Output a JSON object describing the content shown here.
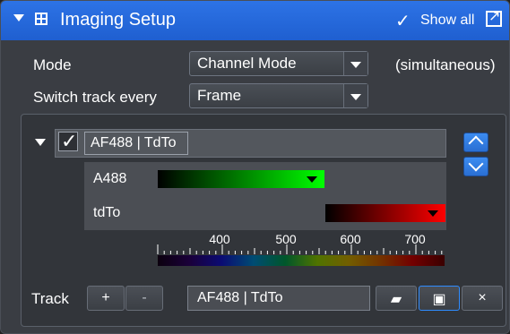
{
  "header": {
    "title": "Imaging Setup",
    "show_all_label": "Show all"
  },
  "settings": {
    "mode_label": "Mode",
    "mode_value": "Channel Mode",
    "mode_note": "(simultaneous)",
    "switch_label": "Switch track every",
    "switch_value": "Frame"
  },
  "track": {
    "name": "AF488 | TdTo",
    "checked": true,
    "channels": [
      {
        "name": "A488",
        "color": "#00ff00"
      },
      {
        "name": "tdTo",
        "color": "#ff0000"
      }
    ]
  },
  "wavelength_scale": {
    "ticks": [
      "400",
      "500",
      "600",
      "700"
    ]
  },
  "footer": {
    "track_label": "Track",
    "add_label": "+",
    "remove_label": "-",
    "track_name_value": "AF488 | TdTo",
    "close_label": "×"
  }
}
